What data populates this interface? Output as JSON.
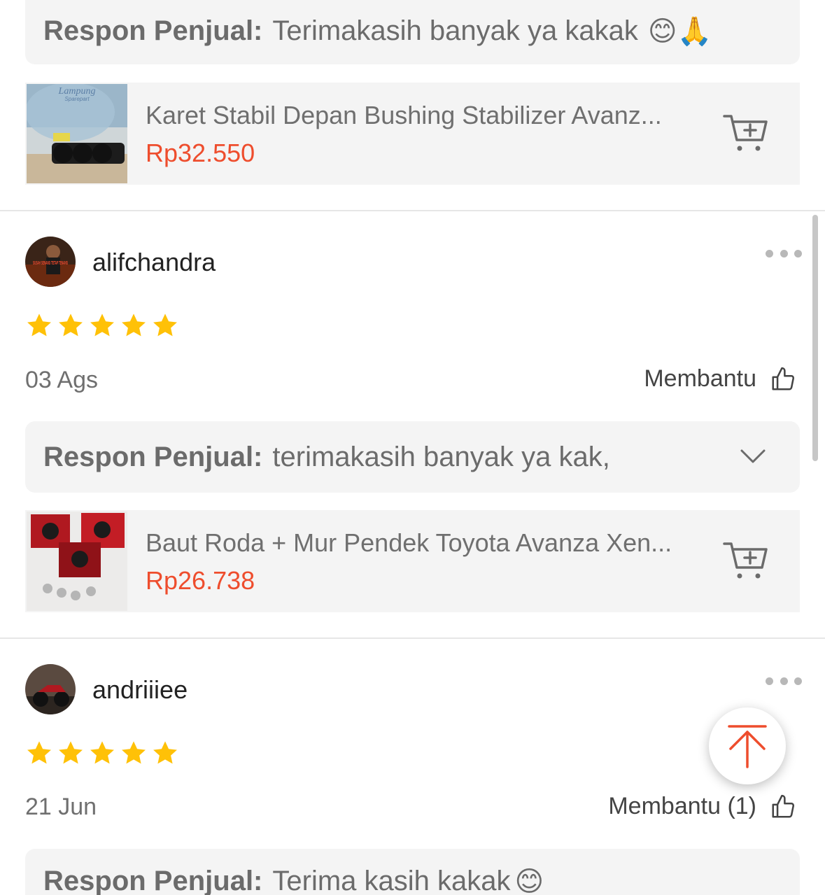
{
  "reviews": [
    {
      "response_label": "Respon Penjual:",
      "response_text": "Terimakasih banyak ya kakak",
      "response_emoji": "😊🙏",
      "product": {
        "name": "Karet Stabil Depan Bushing Stabilizer Avanz...",
        "price": "Rp32.550",
        "thumb_brand_text": "Lampung",
        "thumb_brand_sub": "Sparepart"
      }
    },
    {
      "username": "alifchandra",
      "avatar_overlay_text": "SUSAH SENANG TETAP TENANG",
      "rating": 5,
      "date": "03 Ags",
      "helpful_label": "Membantu",
      "response_label": "Respon Penjual:",
      "response_text": "terimakasih banyak ya kak,",
      "product": {
        "name": "Baut Roda + Mur Pendek Toyota Avanza Xen...",
        "price": "Rp26.738"
      }
    },
    {
      "username": "andriiiee",
      "rating": 5,
      "date": "21 Jun",
      "helpful_label": "Membantu (1)",
      "response_label": "Respon Penjual:",
      "response_text": "Terima kasih kakak",
      "response_emoji": "😊"
    }
  ],
  "colors": {
    "price": "#ee4d2d",
    "star": "#ffc107",
    "card_bg": "#f4f4f4",
    "accent": "#ee4d2d"
  },
  "icons": {
    "cart": "add-to-cart-icon",
    "more": "more-dots-icon",
    "helpful": "thumbs-up-icon",
    "expand": "chevron-down-icon",
    "scroll_top": "arrow-up-icon"
  }
}
